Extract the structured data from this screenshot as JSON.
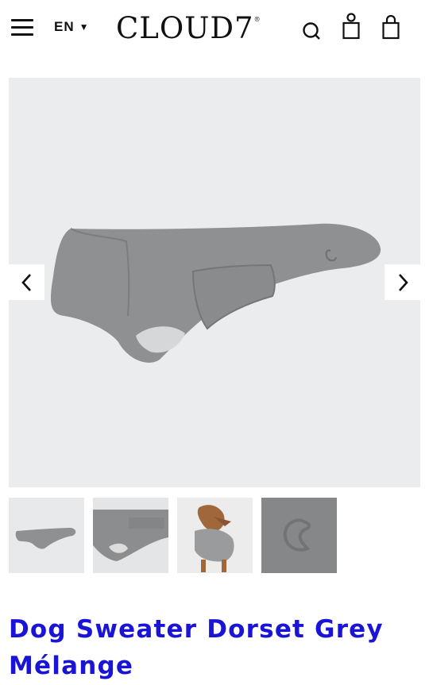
{
  "header": {
    "menu_icon": "hamburger-menu-icon",
    "language": "EN",
    "language_caret": "▼",
    "logo": "CLOUD7",
    "logo_mark": "®",
    "icons": [
      "search-icon",
      "account-icon",
      "shopping-bag-icon"
    ]
  },
  "gallery": {
    "prev_icon": "chevron-left-icon",
    "next_icon": "chevron-right-icon",
    "thumbnails": [
      "thumbnail-side-view",
      "thumbnail-detail",
      "thumbnail-dog-wearing",
      "thumbnail-logo-closeup"
    ]
  },
  "product": {
    "title": "Dog Sweater Dorset Grey Mélange"
  },
  "colors": {
    "accent": "#1a14d6",
    "gallery_bg": "#ebeced",
    "sweater": "#8f9091"
  }
}
